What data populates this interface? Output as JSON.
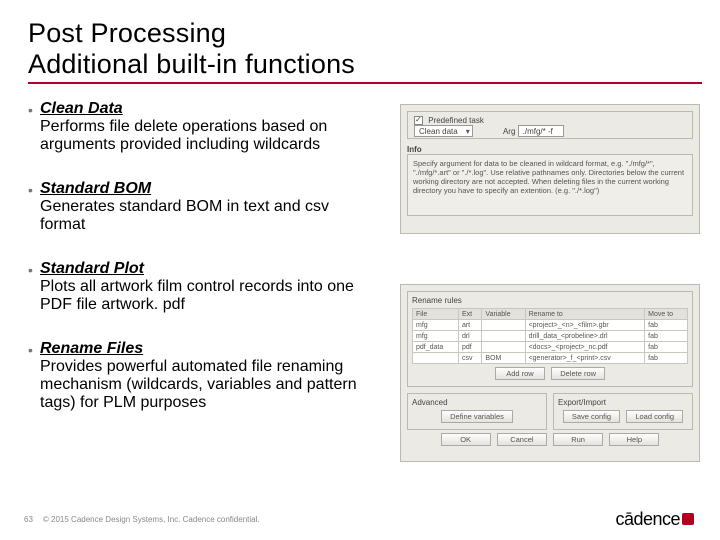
{
  "title": {
    "line1": "Post Processing",
    "line2": "Additional built-in functions"
  },
  "bullets": [
    {
      "head": "Clean Data",
      "desc": "Performs file delete operations based on arguments provided including wildcards"
    },
    {
      "head": "Standard BOM",
      "desc": "Generates standard BOM in text and csv format"
    },
    {
      "head": "Standard Plot",
      "desc": "Plots all artwork film control records into one PDF file artwork. pdf"
    },
    {
      "head": "Rename Files",
      "desc": "Provides powerful automated file renaming mechanism (wildcards, variables and pattern tags) for PLM purposes"
    }
  ],
  "panel1": {
    "group_label": "Predefined task",
    "task_value": "Clean data",
    "arg_label": "Arg",
    "arg_value": "./mfg/* -f",
    "info_label": "Info",
    "info_text": "Specify argument for data to be cleaned in wildcard format, e.g. \"./mfg/*\", \"./mfg/*.art\" or \"./*.log\". Use relative pathnames only. Directories below the current working directory are not accepted. When deleting files in the current working directory you have to specify an extention. (e.g. \"./*.log\")"
  },
  "panel2": {
    "group_label": "Rename rules",
    "headers": [
      "File",
      "Ext",
      "Variable",
      "Rename to",
      "Move to"
    ],
    "rows": [
      [
        "mfg",
        "art",
        "",
        "<project>_<n>_<film>.gbr",
        "fab"
      ],
      [
        "mfg",
        "drl",
        "",
        "drill_data_<probeline>.drl",
        "fab"
      ],
      [
        "pdf_data",
        "pdf",
        "",
        "<docs>_<project>_nc.pdf",
        "fab"
      ],
      [
        "",
        "csv",
        "BOM",
        "<generator>_f_<print>.csv",
        "fab"
      ]
    ],
    "btn_addrow": "Add row",
    "btn_delrow": "Delete row",
    "sec_adv": "Advanced",
    "btn_defvar": "Define variables",
    "sec_exp": "Export/Import",
    "btn_save": "Save config",
    "btn_load": "Load config",
    "btn_ok": "OK",
    "btn_cancel": "Cancel",
    "btn_run": "Run",
    "btn_help": "Help"
  },
  "footer": {
    "page": "63",
    "copyright": "© 2015 Cadence Design Systems, Inc. Cadence confidential.",
    "logo": "cādence"
  }
}
